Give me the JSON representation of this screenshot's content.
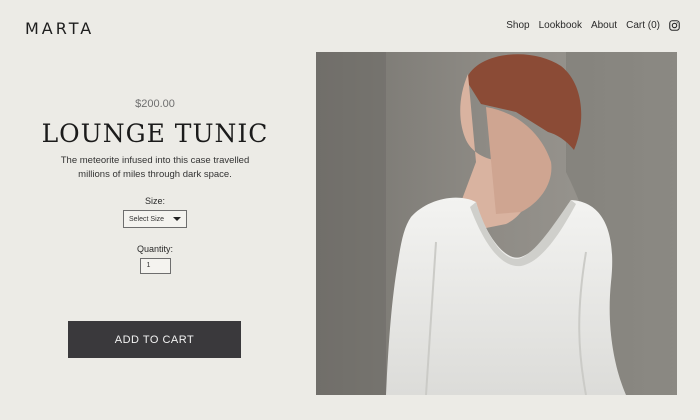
{
  "header": {
    "logo": "MARTA",
    "nav": [
      "Shop",
      "Lookbook",
      "About",
      "Cart (0)"
    ],
    "instagram_icon": "instagram-icon"
  },
  "product": {
    "price": "$200.00",
    "title": "LOUNGE TUNIC",
    "description": "The meteorite infused into this case travelled millions of miles through dark space.",
    "size_label": "Size:",
    "size_select": "Select Size",
    "quantity_label": "Quantity:",
    "quantity_value": "1",
    "add_to_cart": "ADD TO CART"
  },
  "colors": {
    "background": "#ecebe6",
    "button": "#3a393c",
    "button_text": "#f3f3f3"
  }
}
